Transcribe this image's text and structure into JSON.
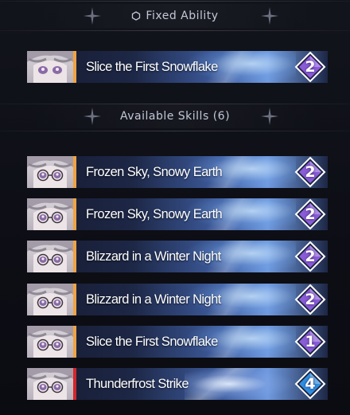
{
  "fixed_section": {
    "title": "Fixed Ability",
    "icon": "hexagon-icon"
  },
  "available_section": {
    "title": "Available Skills (6)"
  },
  "fixed_skill": {
    "name": "Slice the First Snowflake",
    "cost": "2",
    "cost_color": "#8a5cd8",
    "accent": "#f0a442"
  },
  "skills": [
    {
      "name": "Frozen Sky, Snowy Earth",
      "cost": "2",
      "cost_color": "#8a5cd8",
      "accent": "#f0a442"
    },
    {
      "name": "Frozen Sky, Snowy Earth",
      "cost": "2",
      "cost_color": "#8a5cd8",
      "accent": "#f0a442"
    },
    {
      "name": "Blizzard in a Winter Night",
      "cost": "2",
      "cost_color": "#8a5cd8",
      "accent": "#f0a442"
    },
    {
      "name": "Blizzard in a Winter Night",
      "cost": "2",
      "cost_color": "#8a5cd8",
      "accent": "#f0a442"
    },
    {
      "name": "Slice the First Snowflake",
      "cost": "1",
      "cost_color": "#8a5cd8",
      "accent": "#f0a442"
    },
    {
      "name": "Thunderfrost Strike",
      "cost": "4",
      "cost_color": "#2f8ee0",
      "accent": "#d4262c"
    }
  ]
}
